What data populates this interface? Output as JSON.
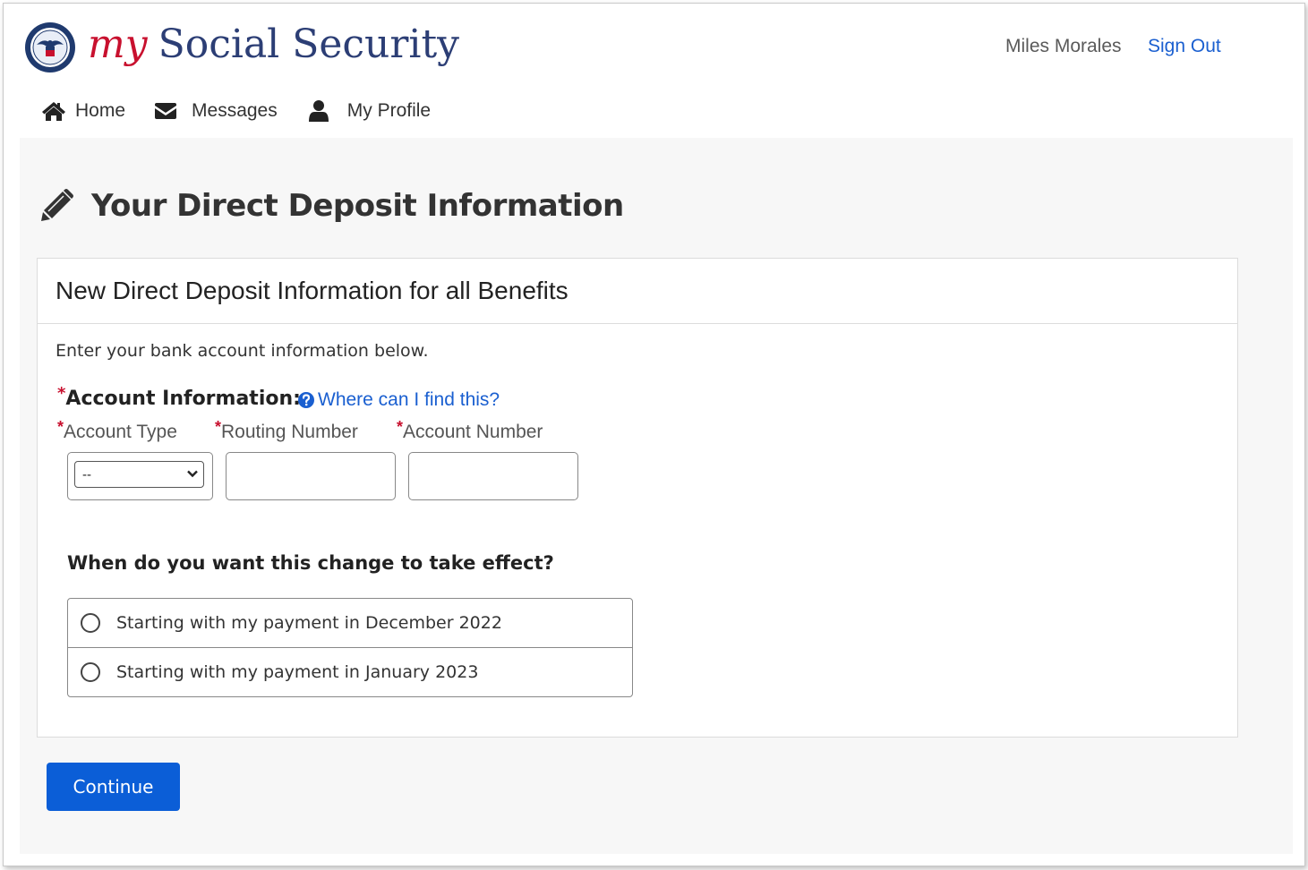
{
  "header": {
    "brand_my": "my",
    "brand_rest": "Social Security",
    "user_name": "Miles Morales",
    "sign_out": "Sign Out"
  },
  "nav": {
    "items": [
      {
        "label": "Home",
        "icon": "home-icon"
      },
      {
        "label": "Messages",
        "icon": "envelope-icon"
      },
      {
        "label": "My Profile",
        "icon": "user-icon"
      }
    ]
  },
  "page": {
    "title": "Your Direct Deposit Information",
    "title_icon": "pencil-icon"
  },
  "panel": {
    "heading": "New Direct Deposit Information for all Benefits",
    "intro": "Enter your bank account information below.",
    "account_label": "Account Information:",
    "help_link": "Where can I find this?",
    "required_mark": "*",
    "fields": {
      "account_type_label": "Account Type",
      "routing_label": "Routing Number",
      "account_number_label": "Account Number",
      "account_type_value": "--",
      "routing_value": "",
      "account_number_value": ""
    },
    "question": "When do you want this change to take effect?",
    "options": [
      "Starting with my payment in December 2022",
      "Starting with my payment in January 2023"
    ]
  },
  "actions": {
    "continue": "Continue"
  },
  "colors": {
    "brand_red": "#c8102e",
    "brand_navy": "#2c3e75",
    "link_blue": "#1a5fd0",
    "button_blue": "#0b5ed7",
    "content_bg": "#f7f7f7"
  }
}
